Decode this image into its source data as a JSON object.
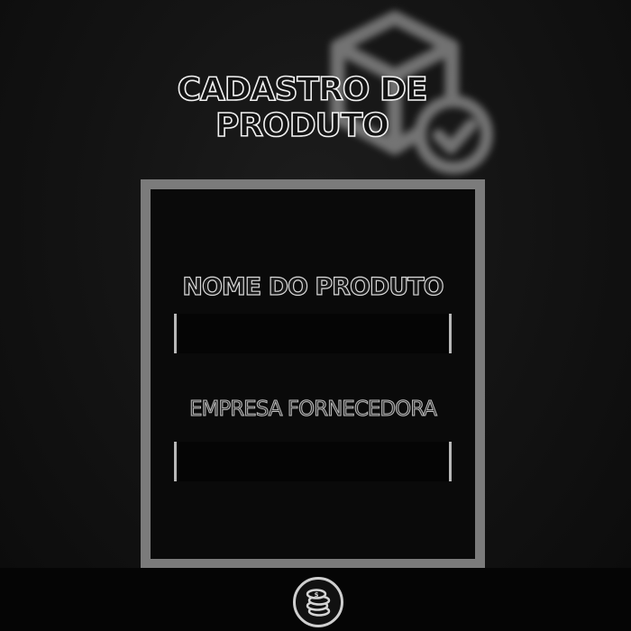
{
  "page": {
    "title": "CADASTRO DE PRODUTO"
  },
  "form": {
    "product_name": {
      "label": "NOME DO PRODUTO",
      "value": ""
    },
    "supplier": {
      "label": "EMPRESA FORNECEDORA",
      "value": ""
    }
  },
  "icons": {
    "header": "box-check-icon",
    "footer": "coins-icon"
  },
  "colors": {
    "background": "#0d0d0d",
    "frame": "#7b7b7b",
    "text_outline": "#f2f2f2",
    "input_background": "#050505"
  }
}
